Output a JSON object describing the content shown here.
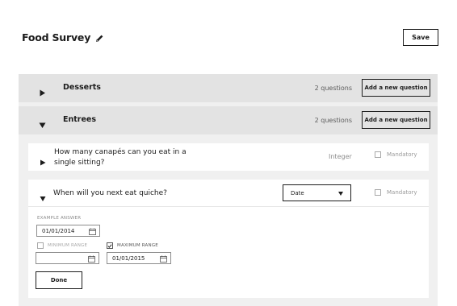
{
  "header": {
    "title": "Food Survey",
    "save_label": "Save",
    "edit_icon": "pencil-icon"
  },
  "sections": [
    {
      "label": "Desserts",
      "count": "2 questions",
      "add_label": "Add a new question",
      "expanded": false
    },
    {
      "label": "Entrees",
      "count": "2 questions",
      "add_label": "Add a new question",
      "expanded": true
    }
  ],
  "questions": [
    {
      "text": "How many canapés can you eat in a single sitting?",
      "type": "Integer",
      "mandatory_label": "Mandatory",
      "mandatory": false,
      "expanded": false
    },
    {
      "text": "When will you next eat quiche?",
      "type": "Date",
      "mandatory_label": "Mandatory",
      "mandatory": false,
      "expanded": true,
      "example_label": "EXAMPLE ANSWER",
      "example_value": "01/01/2014",
      "min_label": "MINIMUM RANGE",
      "min_checked": false,
      "min_value": "",
      "max_label": "MAXIMUM RANGE",
      "max_checked": true,
      "max_value": "01/01/2015",
      "done_label": "Done"
    }
  ]
}
